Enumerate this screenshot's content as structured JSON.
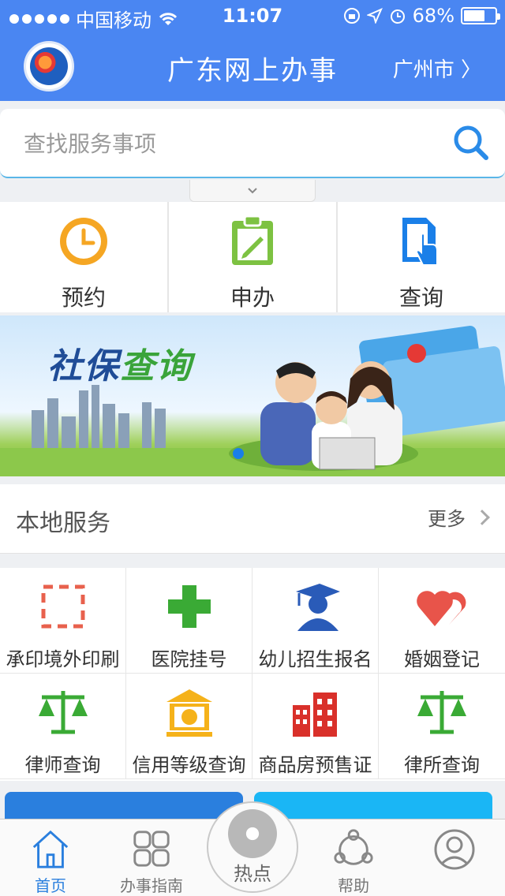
{
  "status_bar": {
    "carrier": "中国移动",
    "time": "11:07",
    "battery": "68%",
    "battery_level": 0.68
  },
  "header": {
    "title": "广东网上办事",
    "city": "广州市 〉"
  },
  "search": {
    "placeholder": "查找服务事项"
  },
  "quick_actions": [
    {
      "label": "预约",
      "icon": "clock-refresh-icon",
      "color": "#f5a623"
    },
    {
      "label": "申办",
      "icon": "clipboard-edit-icon",
      "color": "#7dc242"
    },
    {
      "label": "查询",
      "icon": "tap-document-icon",
      "color": "#1a7fe8"
    }
  ],
  "banner": {
    "title_part1": "社保",
    "title_part2": "查询"
  },
  "local_services": {
    "title": "本地服务",
    "more": "更多",
    "items": [
      {
        "label": "承印境外印刷",
        "icon": "dashed-frame-icon"
      },
      {
        "label": "医院挂号",
        "icon": "medical-cross-icon"
      },
      {
        "label": "幼儿招生报名",
        "icon": "graduate-icon"
      },
      {
        "label": "婚姻登记",
        "icon": "hearts-icon"
      },
      {
        "label": "律师查询",
        "icon": "scales-icon"
      },
      {
        "label": "信用等级查询",
        "icon": "bank-building-icon"
      },
      {
        "label": "商品房预售证",
        "icon": "buildings-icon"
      },
      {
        "label": "律所查询",
        "icon": "scales-icon"
      }
    ]
  },
  "tabbar": {
    "home": "首页",
    "guide": "办事指南",
    "hot": "热点",
    "help": "帮助",
    "profile": ""
  }
}
